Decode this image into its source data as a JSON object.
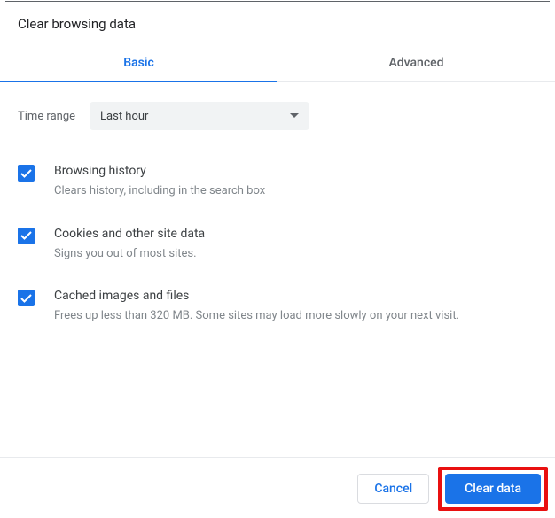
{
  "title": "Clear browsing data",
  "tabs": {
    "basic": "Basic",
    "advanced": "Advanced"
  },
  "timerange": {
    "label": "Time range",
    "value": "Last hour"
  },
  "options": [
    {
      "title": "Browsing history",
      "desc": "Clears history, including in the search box"
    },
    {
      "title": "Cookies and other site data",
      "desc": "Signs you out of most sites."
    },
    {
      "title": "Cached images and files",
      "desc": "Frees up less than 320 MB. Some sites may load more slowly on your next visit."
    }
  ],
  "buttons": {
    "cancel": "Cancel",
    "clear": "Clear data"
  }
}
